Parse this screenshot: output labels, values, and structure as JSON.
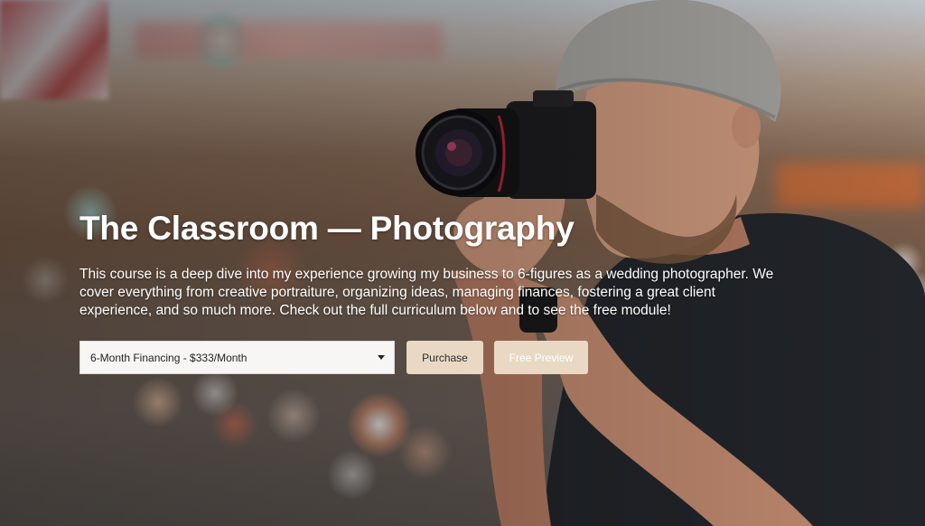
{
  "hero": {
    "title": "The Classroom — Photography",
    "description": "This course is a deep dive into my experience growing my business to 6-figures as a wedding photographer. We cover everything from creative portraiture, organizing ideas, managing finances, fostering a great client experience, and so much more. Check out the full curriculum below and to see the free module!"
  },
  "purchase_form": {
    "plan_select": {
      "selected": "6-Month Financing - $333/Month"
    },
    "purchase_label": "Purchase",
    "preview_label": "Free Preview"
  },
  "colors": {
    "button_bg": "#e9d9c4",
    "select_bg": "#f7f6f5",
    "title_text": "#ffffff"
  }
}
